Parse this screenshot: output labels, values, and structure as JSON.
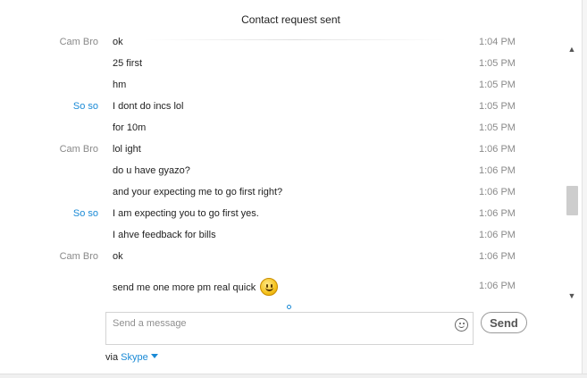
{
  "header": {
    "title": "Contact request sent"
  },
  "messages": [
    {
      "sender": "Cam Bro",
      "sender_is_me": false,
      "text": "ok",
      "time": "1:04 PM"
    },
    {
      "sender": "",
      "sender_is_me": false,
      "text": "25 first",
      "time": "1:05 PM"
    },
    {
      "sender": "",
      "sender_is_me": false,
      "text": "hm",
      "time": "1:05 PM"
    },
    {
      "sender": "So so",
      "sender_is_me": true,
      "text": "I dont do incs lol",
      "time": "1:05 PM"
    },
    {
      "sender": "",
      "sender_is_me": true,
      "text": "for 10m",
      "time": "1:05 PM"
    },
    {
      "sender": "Cam Bro",
      "sender_is_me": false,
      "text": "lol ight",
      "time": "1:06 PM"
    },
    {
      "sender": "",
      "sender_is_me": false,
      "text": "do u have gyazo?",
      "time": "1:06 PM"
    },
    {
      "sender": "",
      "sender_is_me": false,
      "text": "and your expecting me to go first right?",
      "time": "1:06 PM"
    },
    {
      "sender": "So so",
      "sender_is_me": true,
      "text": "I am expecting you to go first yes.",
      "time": "1:06 PM"
    },
    {
      "sender": "",
      "sender_is_me": true,
      "text": "I ahve feedback for bills",
      "time": "1:06 PM"
    },
    {
      "sender": "Cam Bro",
      "sender_is_me": false,
      "text": "ok",
      "time": "1:06 PM"
    },
    {
      "sender": "",
      "sender_is_me": false,
      "text": "send me one more pm real quick",
      "time": "1:06 PM",
      "emoticon": "smiley-icon"
    }
  ],
  "composer": {
    "placeholder": "Send a message",
    "value": "",
    "send_label": "Send",
    "emoji_icon": "emoticon-icon"
  },
  "footer": {
    "via_label": "via",
    "service_label": "Skype",
    "service_icon": "caret-down-icon"
  },
  "colors": {
    "accent": "#1a8ad6",
    "muted_text": "#8a8a8a",
    "text": "#222222"
  }
}
